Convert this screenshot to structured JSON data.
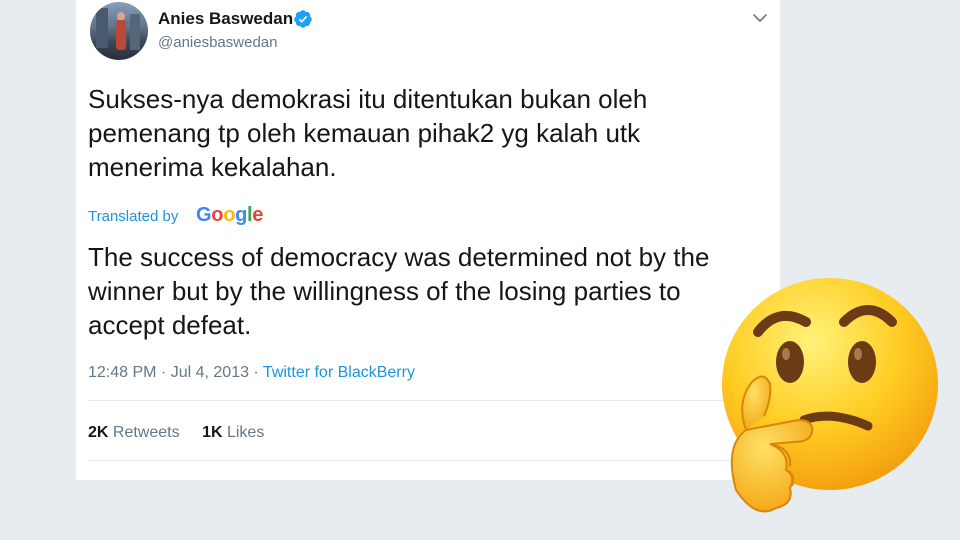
{
  "tweet": {
    "author_name": "Anies Baswedan",
    "author_handle": "@aniesbaswedan",
    "text": "Sukses-nya demokrasi itu ditentukan bukan oleh pemenang tp oleh kemauan pihak2 yg kalah utk menerima kekalahan.",
    "translated_by_label": "Translated by",
    "translator_brand": "Google",
    "translation": "The success of democracy was determined not by the winner but by the willingness of the losing parties to accept defeat.",
    "timestamp": "12:48 PM · Jul 4, 2013",
    "separator": " · ",
    "source": "Twitter for BlackBerry",
    "retweets_count": "2K",
    "retweets_label": "Retweets",
    "likes_count": "1K",
    "likes_label": "Likes"
  },
  "colors": {
    "page_background": "#e6ecf0",
    "link": "#1b95e0",
    "verified": "#1da1f2",
    "google_blue": "#4285f4",
    "google_red": "#ea4335",
    "google_yellow": "#fbbc05",
    "google_green": "#34a853"
  },
  "icons": {
    "verified": "verified-badge-icon",
    "menu": "chevron-down-icon",
    "emoji": "thinking-face-emoji"
  }
}
